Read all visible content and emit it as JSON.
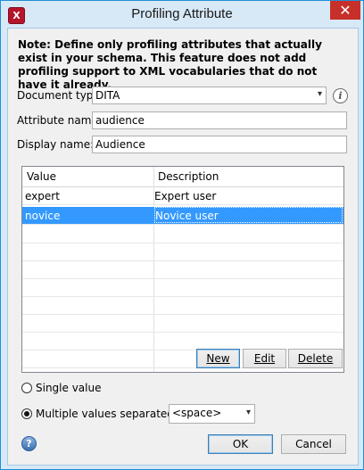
{
  "window": {
    "title": "Profiling Attribute",
    "app_icon_glyph": "X",
    "close_glyph": "✕"
  },
  "note": "Note: Define only profiling attributes that actually exist in your schema. This feature does not add profiling support to XML vocabularies that do not have it already.",
  "form": {
    "document_type": {
      "label": "Document type:",
      "value": "DITA"
    },
    "attribute_name": {
      "label": "Attribute name:",
      "value": "audience"
    },
    "display_name": {
      "label": "Display name:",
      "value": "Audience"
    }
  },
  "table": {
    "columns": [
      "Value",
      "Description"
    ],
    "rows": [
      {
        "value": "expert",
        "description": "Expert user",
        "selected": false
      },
      {
        "value": "novice",
        "description": "Novice user",
        "selected": true
      }
    ]
  },
  "buttons": {
    "new": "New",
    "edit": "Edit",
    "delete": "Delete",
    "ok": "OK",
    "cancel": "Cancel"
  },
  "options": {
    "single_value": {
      "label": "Single value",
      "selected": false
    },
    "multiple_values": {
      "label": "Multiple values separated by:",
      "selected": true,
      "separator": "<space>"
    }
  },
  "icons": {
    "info": "i",
    "help": "?",
    "dropdown": "▾"
  },
  "colors": {
    "selection": "#3399ff",
    "titlebar": "#d7e8f7",
    "close": "#c7302a"
  }
}
